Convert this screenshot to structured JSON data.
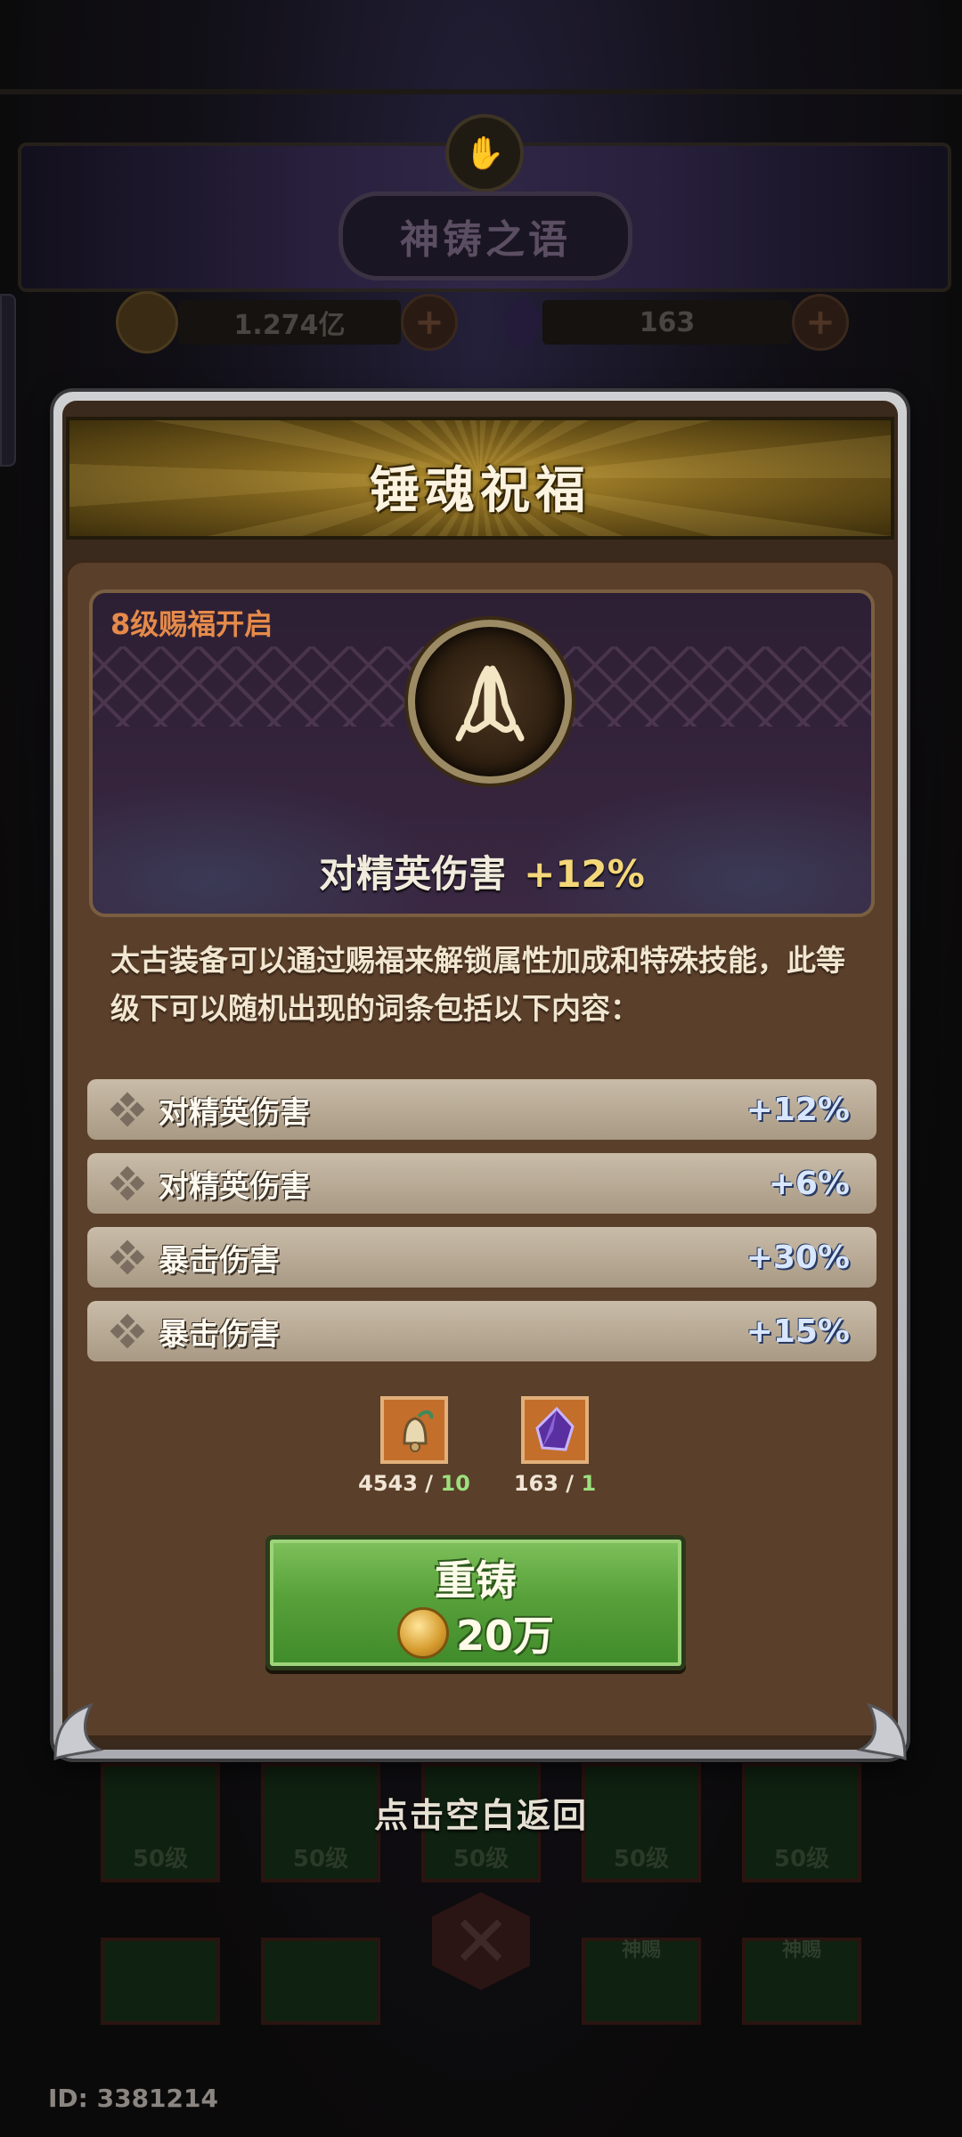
{
  "background": {
    "title": "神铸之语",
    "gold_amount": "1.274亿",
    "gem_amount": "163",
    "equipment_levels": [
      "50级",
      "50级",
      "50级",
      "50级",
      "50级"
    ],
    "second_row_tags": [
      "神赐",
      "神赐"
    ],
    "close_hint": "点击空白返回",
    "user_id": "ID: 3381214"
  },
  "modal": {
    "title": "锤魂祝福",
    "feature": {
      "unlock_tag": "8级赐福开启",
      "emblem_icon": "praying-hands-icon",
      "stat_name": "对精英伤害",
      "stat_value": "+12%"
    },
    "description": "太古装备可以通过赐福来解锁属性加成和特殊技能，此等级下可以随机出现的词条包括以下内容：",
    "attributes": [
      {
        "name": "对精英伤害",
        "value": "+12%"
      },
      {
        "name": "对精英伤害",
        "value": "+6%"
      },
      {
        "name": "暴击伤害",
        "value": "+30%"
      },
      {
        "name": "暴击伤害",
        "value": "+15%"
      }
    ],
    "costs": [
      {
        "icon": "bell-icon",
        "have": "4543",
        "need": "10"
      },
      {
        "icon": "purple-gem-icon",
        "have": "163",
        "need": "1"
      }
    ],
    "recast_button": {
      "label": "重铸",
      "price": "20万",
      "currency_icon": "gold-coin-icon"
    }
  },
  "colors": {
    "accent_gold": "#f4d778",
    "button_green": "#58a13a",
    "tag_orange": "#e58a4a",
    "value_blue": "#d8e7ff"
  }
}
